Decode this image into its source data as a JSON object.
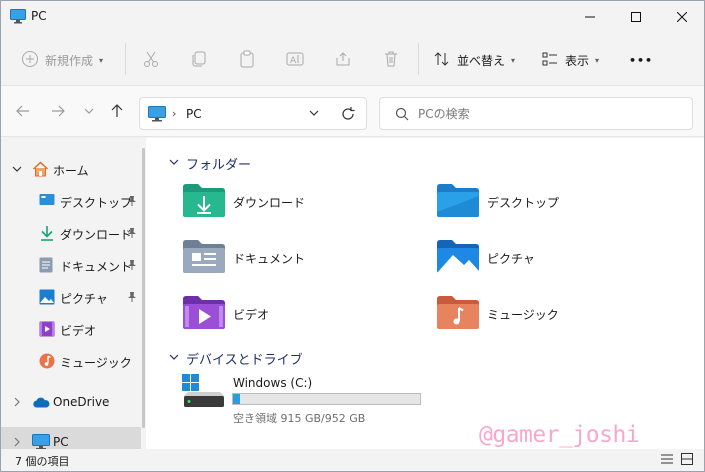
{
  "window": {
    "title": "PC"
  },
  "toolbar": {
    "new_label": "新規作成",
    "sort_label": "並べ替え",
    "view_label": "表示",
    "more_label": "•••"
  },
  "address": {
    "path": "PC",
    "separator": "›"
  },
  "search": {
    "placeholder": "PCの検索"
  },
  "sidebar": {
    "items": [
      {
        "label": "ホーム",
        "icon": "home-icon"
      },
      {
        "label": "デスクトップ",
        "icon": "desktop-icon",
        "pinned": true
      },
      {
        "label": "ダウンロード",
        "icon": "download-icon",
        "pinned": true
      },
      {
        "label": "ドキュメント",
        "icon": "document-icon",
        "pinned": true
      },
      {
        "label": "ピクチャ",
        "icon": "pictures-icon",
        "pinned": true
      },
      {
        "label": "ビデオ",
        "icon": "video-icon"
      },
      {
        "label": "ミュージック",
        "icon": "music-icon"
      },
      {
        "label": "OneDrive",
        "icon": "cloud-icon"
      },
      {
        "label": "PC",
        "icon": "pc-icon",
        "selected": true
      }
    ]
  },
  "main": {
    "folders_header": "フォルダー",
    "folders": [
      {
        "name": "ダウンロード",
        "icon": "download-folder-icon"
      },
      {
        "name": "デスクトップ",
        "icon": "desktop-folder-icon"
      },
      {
        "name": "ドキュメント",
        "icon": "documents-folder-icon"
      },
      {
        "name": "ピクチャ",
        "icon": "pictures-folder-icon"
      },
      {
        "name": "ビデオ",
        "icon": "videos-folder-icon"
      },
      {
        "name": "ミュージック",
        "icon": "music-folder-icon"
      }
    ],
    "drives_header": "デバイスとドライブ",
    "drives": [
      {
        "name": "Windows (C:)",
        "info": "空き領域 915 GB/952 GB",
        "used_fraction": 0.039
      }
    ]
  },
  "status": {
    "count": "7 個の項目"
  },
  "watermark": "@gamer_joshi",
  "colors": {
    "accent": "#0067c0",
    "header_text": "#1f2f6b",
    "drive_bar": "#26a0da",
    "watermark": "#f7a8ce"
  }
}
